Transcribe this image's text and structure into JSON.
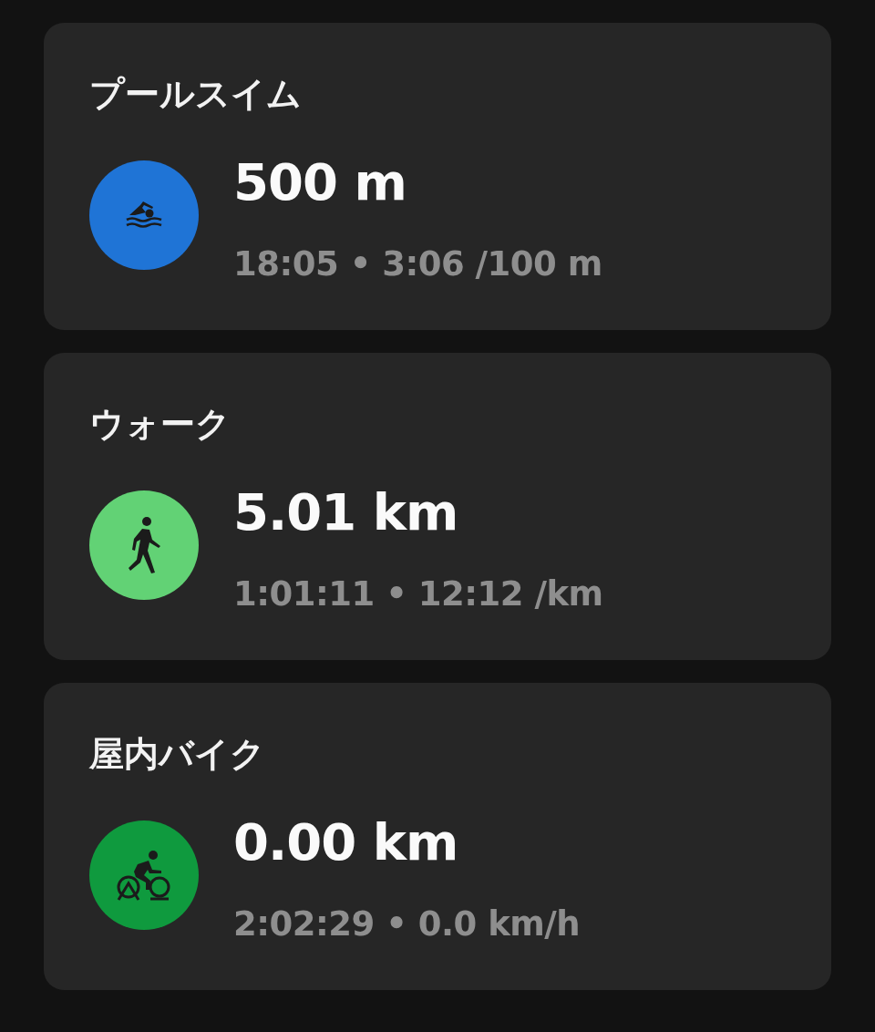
{
  "workouts": [
    {
      "title": "プールスイム",
      "kind": "swim",
      "color": "#1f74d6",
      "distance": "500 m",
      "details": "18:05 • 3:06 /100 m"
    },
    {
      "title": "ウォーク",
      "kind": "walk",
      "color": "#62d275",
      "distance": "5.01 km",
      "details": "1:01:11 • 12:12 /km"
    },
    {
      "title": "屋内バイク",
      "kind": "bike",
      "color": "#0f9a3e",
      "distance": "0.00 km",
      "details": "2:02:29 • 0.0 km/h"
    }
  ]
}
